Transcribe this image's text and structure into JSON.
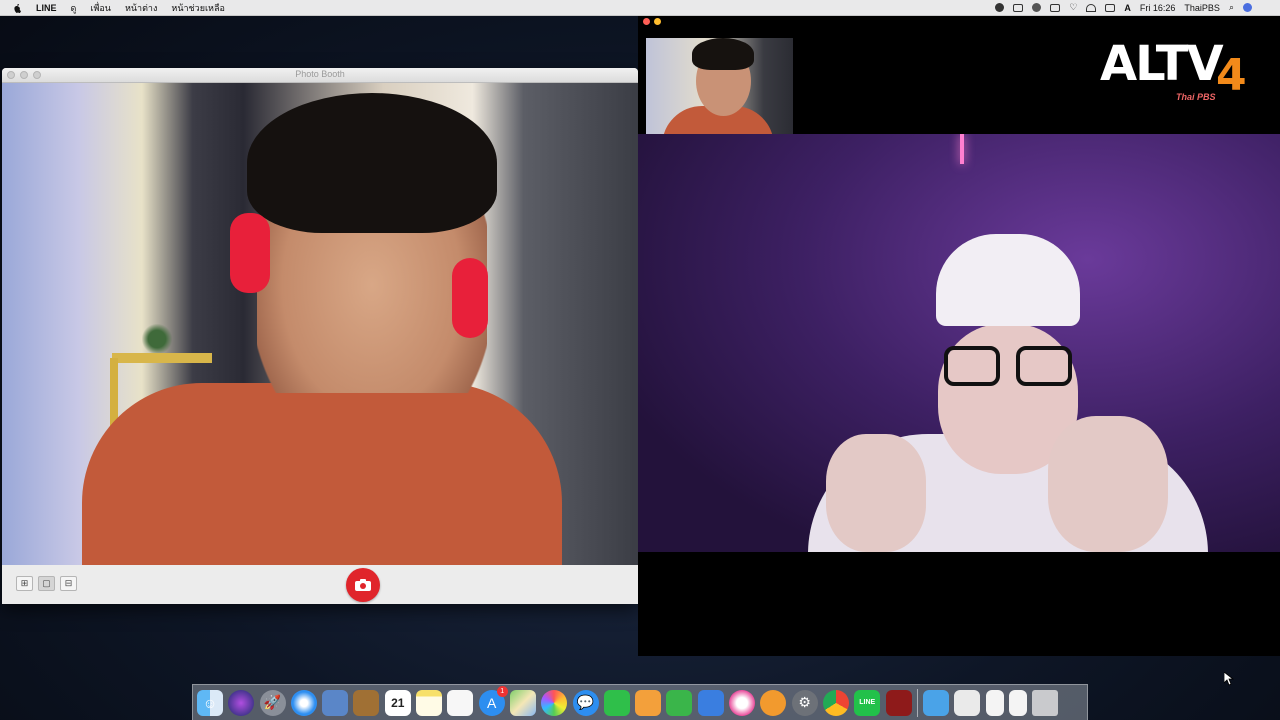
{
  "menubar": {
    "app_name": "LINE",
    "menus": [
      "ดู",
      "เพื่อน",
      "หน้าต่าง",
      "หน้าช่วยเหลือ"
    ],
    "clock": "Fri 16:26",
    "user": "ThaiPBS"
  },
  "photo_booth": {
    "title": "Photo Booth",
    "view_buttons": [
      "⊞",
      "▢",
      "⊟"
    ],
    "active_view": 1
  },
  "broadcaster_logo": {
    "text": "ALTV",
    "number": "4",
    "subtitle": "Thai PBS"
  },
  "dock": {
    "calendar_day": "21",
    "app_store_badge": "1",
    "apps": [
      "finder-icon",
      "siri-icon",
      "launchpad-icon",
      "safari-icon",
      "preview-icon",
      "notebook-icon",
      "calendar-icon",
      "notes-icon",
      "reminders-icon",
      "app-store-icon",
      "maps-icon",
      "photos-icon",
      "messages-icon",
      "facetime-icon",
      "pages-icon",
      "numbers-icon",
      "keynote-icon",
      "itunes-icon",
      "ibooks-icon",
      "system-preferences-icon",
      "chrome-icon",
      "line-icon",
      "photo-booth-icon",
      "downloads-folder-icon",
      "file-icon-1",
      "file-icon-2",
      "file-icon-3",
      "trash-icon"
    ]
  },
  "colors": {
    "shutter": "#e0252b",
    "line_green": "#22c14a",
    "logo_orange": "#f28a1a"
  }
}
